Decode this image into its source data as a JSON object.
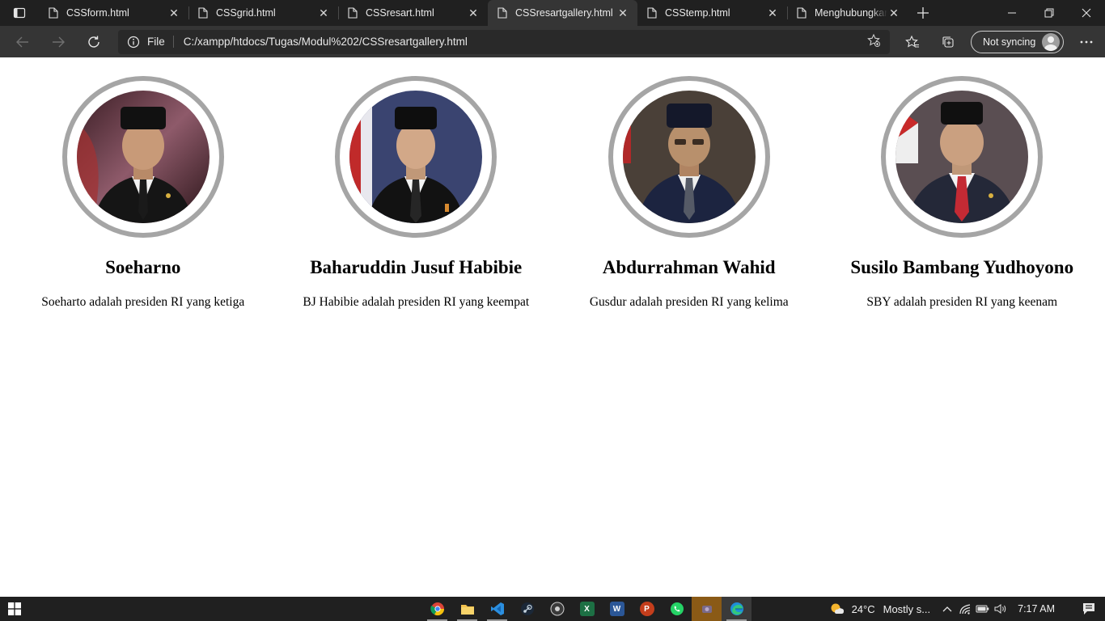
{
  "browser": {
    "tabs": [
      {
        "title": "CSSform.html",
        "active": false
      },
      {
        "title": "CSSgrid.html",
        "active": false
      },
      {
        "title": "CSSresart.html",
        "active": false
      },
      {
        "title": "CSSresartgallery.html",
        "active": true
      },
      {
        "title": "CSStemp.html",
        "active": false
      },
      {
        "title": "Menghubungkan HTML",
        "active": false
      }
    ],
    "address": {
      "scheme_label": "File",
      "url": "C:/xampp/htdocs/Tugas/Modul%202/CSSresartgallery.html"
    },
    "sync_label": "Not syncing"
  },
  "gallery": {
    "cards": [
      {
        "name": "Soeharno",
        "description": "Soeharto adalah presiden RI yang ketiga"
      },
      {
        "name": "Baharuddin Jusuf Habibie",
        "description": "BJ Habibie adalah presiden RI yang keempat"
      },
      {
        "name": "Abdurrahman Wahid",
        "description": "Gusdur adalah presiden RI yang kelima"
      },
      {
        "name": "Susilo Bambang Yudhoyono",
        "description": "SBY adalah presiden RI yang keenam"
      }
    ]
  },
  "taskbar": {
    "weather_temp": "24°C",
    "weather_text": "Mostly s...",
    "time": "7:17 AM",
    "apps": [
      "chrome-icon",
      "file-explorer-icon",
      "vscode-icon",
      "steam-icon",
      "obs-icon",
      "excel-icon",
      "word-icon",
      "powerpoint-icon",
      "whatsapp-icon",
      "app-icon",
      "edge-icon"
    ]
  },
  "colors": {
    "ring": "#a5a5a5",
    "chrome_dark": "#202020",
    "chrome_toolbar": "#353535"
  }
}
